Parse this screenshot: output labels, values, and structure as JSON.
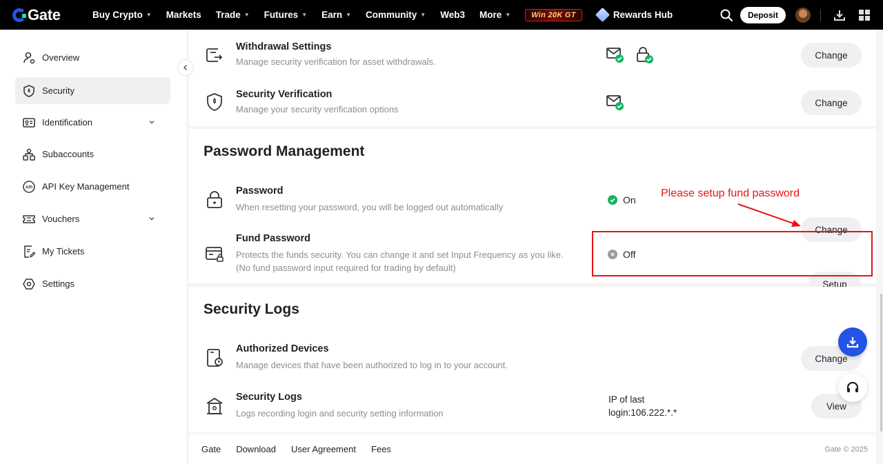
{
  "topnav": {
    "logo": "Gate",
    "items": [
      {
        "label": "Buy Crypto",
        "dropdown": true
      },
      {
        "label": "Markets",
        "dropdown": false
      },
      {
        "label": "Trade",
        "dropdown": true
      },
      {
        "label": "Futures",
        "dropdown": true
      },
      {
        "label": "Earn",
        "dropdown": true
      },
      {
        "label": "Community",
        "dropdown": true
      },
      {
        "label": "Web3",
        "dropdown": false
      },
      {
        "label": "More",
        "dropdown": true
      }
    ],
    "promo": "Win 20K GT",
    "rewards": "Rewards Hub",
    "deposit": "Deposit",
    "icons": [
      "search-icon",
      "avatar",
      "download-icon",
      "apps-grid-icon"
    ]
  },
  "sidebar": {
    "items": [
      {
        "label": "Overview",
        "icon": "user-icon",
        "active": false,
        "expandable": false
      },
      {
        "label": "Security",
        "icon": "shield-icon",
        "active": true,
        "expandable": false
      },
      {
        "label": "Identification",
        "icon": "id-card-icon",
        "active": false,
        "expandable": true
      },
      {
        "label": "Subaccounts",
        "icon": "subaccounts-icon",
        "active": false,
        "expandable": false
      },
      {
        "label": "API Key Management",
        "icon": "api-icon",
        "active": false,
        "expandable": false
      },
      {
        "label": "Vouchers",
        "icon": "voucher-icon",
        "active": false,
        "expandable": true
      },
      {
        "label": "My Tickets",
        "icon": "ticket-icon",
        "active": false,
        "expandable": false
      },
      {
        "label": "Settings",
        "icon": "settings-icon",
        "active": false,
        "expandable": false
      }
    ]
  },
  "security_settings": {
    "rows": [
      {
        "title": "Withdrawal Settings",
        "desc": "Manage security verification for asset withdrawals.",
        "button": "Change"
      },
      {
        "title": "Security Verification",
        "desc": "Manage your security verification options",
        "button": "Change"
      }
    ]
  },
  "password_management": {
    "title": "Password Management",
    "rows": [
      {
        "title": "Password",
        "desc": "When resetting your password, you will be logged out automatically",
        "status": "On",
        "button": "Change"
      },
      {
        "title": "Fund Password",
        "desc": "Protects the funds security. You can change it and set Input Frequency as you like. (No fund password input required for trading by default)",
        "status": "Off",
        "button": "Setup"
      }
    ]
  },
  "security_logs": {
    "title": "Security Logs",
    "rows": [
      {
        "title": "Authorized Devices",
        "desc": "Manage devices that have been authorized to log in to your account.",
        "button": "Change"
      },
      {
        "title": "Security Logs",
        "desc": "Logs recording login and security setting information",
        "ip": "IP of last login:106.222.*.*",
        "button": "View"
      }
    ]
  },
  "annotation": "Please setup fund password",
  "footer": {
    "links": [
      "Gate",
      "Download",
      "User Agreement",
      "Fees"
    ],
    "copyright": "Gate © 2025"
  },
  "colors": {
    "accent": "#2354e6",
    "success": "#14b363",
    "annotation": "#e81313"
  }
}
